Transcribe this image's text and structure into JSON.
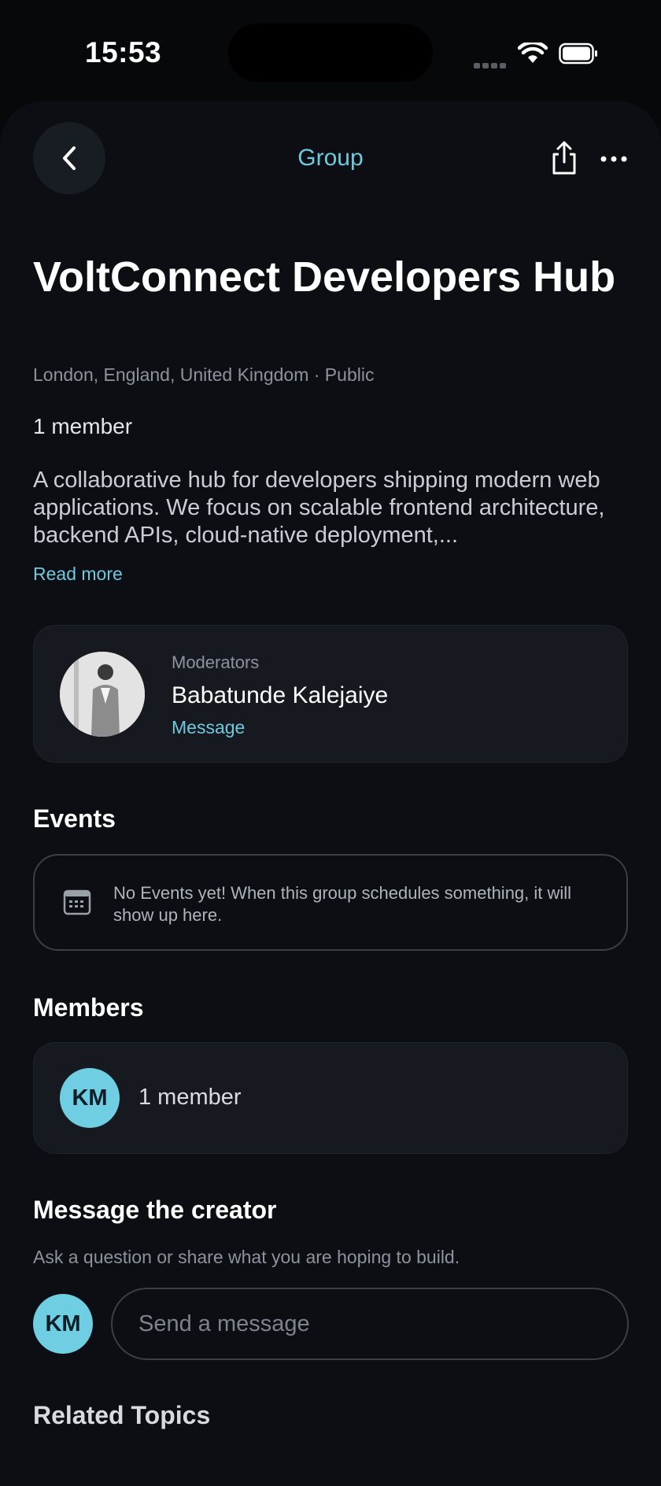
{
  "status_bar": {
    "time": "15:53"
  },
  "header": {
    "title": "Group"
  },
  "group": {
    "name": "VoltConnect Developers Hub",
    "location": "London, England, United Kingdom · Public",
    "member_count": "1 member",
    "description": "A collaborative hub for developers shipping modern web applications. We focus on scalable frontend architecture, backend APIs, cloud-native deployment,...",
    "read_more": "Read more"
  },
  "moderators": {
    "label": "Moderators",
    "name": "Babatunde Kalejaiye",
    "message_label": "Message"
  },
  "events": {
    "heading": "Events",
    "empty_text": "No Events yet! When this group schedules something, it will show up here."
  },
  "members": {
    "heading": "Members",
    "initials": "KM",
    "count_text": "1 member"
  },
  "creator": {
    "heading": "Message the creator",
    "subtitle": "Ask a question or share what you are hoping to build.",
    "user_initials": "KM",
    "input_placeholder": "Send a message"
  },
  "related": {
    "heading": "Related Topics"
  },
  "colors": {
    "accent": "#6fc9dd",
    "avatar_bg": "#6fcee2",
    "background": "#07080a",
    "card": "#161a20"
  }
}
